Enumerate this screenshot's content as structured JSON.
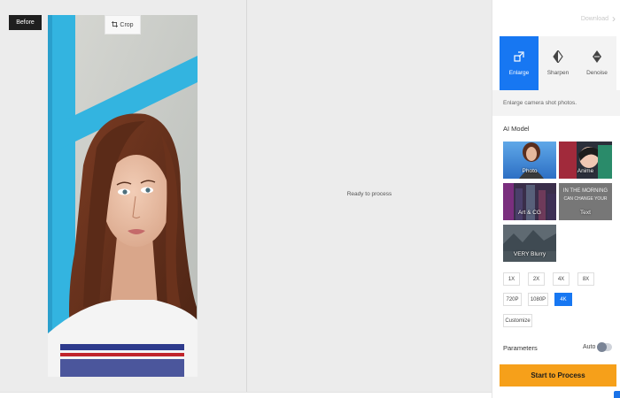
{
  "before_badge": "Before",
  "crop_button": {
    "label": "Crop",
    "icon": "crop-icon"
  },
  "after_pane": {
    "status": "Ready to process"
  },
  "header": {
    "download_label": "Download",
    "chevron_icon": "chevron-right-icon"
  },
  "modes": [
    {
      "label": "Enlarge",
      "icon": "enlarge-icon",
      "active": true
    },
    {
      "label": "Sharpen",
      "icon": "sharpen-icon",
      "active": false
    },
    {
      "label": "Denoise",
      "icon": "denoise-icon",
      "active": false
    }
  ],
  "mode_description": "Enlarge camera shot photos.",
  "ai_model": {
    "title": "AI Model",
    "options": [
      {
        "label": "Photo"
      },
      {
        "label": "Anime"
      },
      {
        "label": "Art & CG"
      },
      {
        "label": "Text",
        "sample_text": [
          "IN THE MORNING",
          "CAN CHANGE YOUR"
        ]
      },
      {
        "label": "VERY Blurry"
      }
    ]
  },
  "resolution": {
    "options": [
      "1X",
      "2X",
      "4X",
      "8X",
      "720P",
      "1080P",
      "4K"
    ],
    "selected": "4K",
    "customize_label": "Customize"
  },
  "parameters": {
    "label": "Parameters",
    "auto_label": "Auto"
  },
  "start_button": "Start to Process",
  "colors": {
    "accent": "#1777f2",
    "start": "#f6a01a",
    "frame": "#33b4e0"
  }
}
